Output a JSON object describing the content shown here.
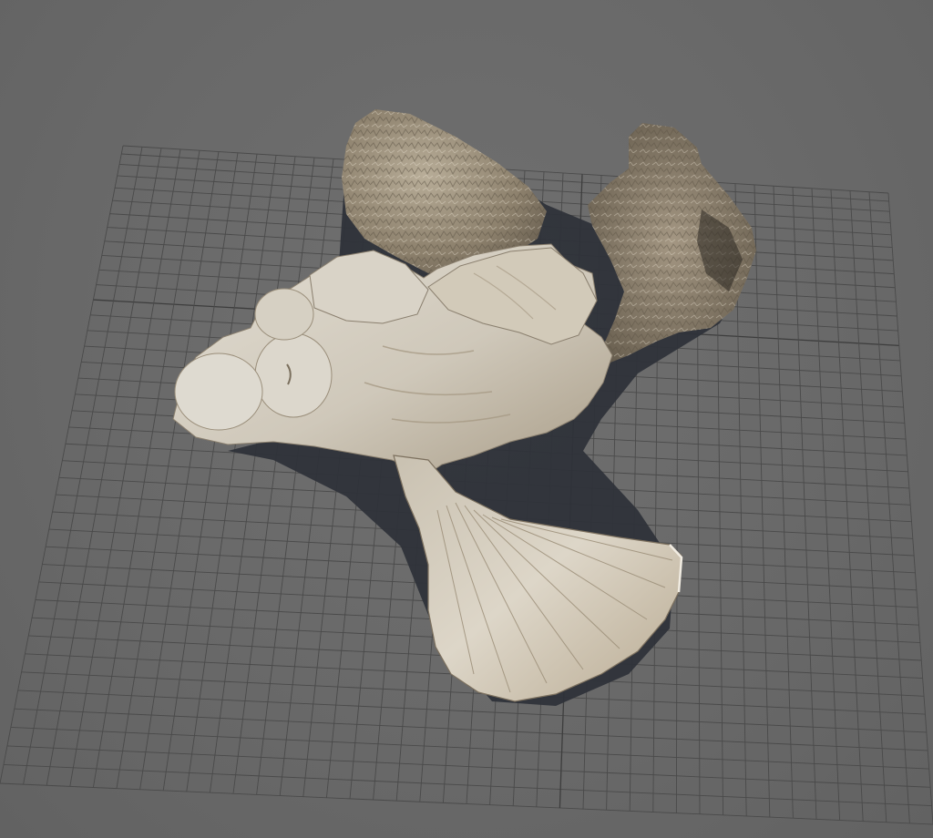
{
  "viewport": {
    "background_color": "#6b6b6b",
    "grid_line_color": "#4a4a4a",
    "grid_major_line_color": "#3d3d3d",
    "grid_visible": true
  },
  "model": {
    "object": "scanned-fossil-mesh",
    "surface_color": "#d4cfc4",
    "shadow_color": "#2e3138",
    "rough_piece_color": "#9a8f7c"
  }
}
